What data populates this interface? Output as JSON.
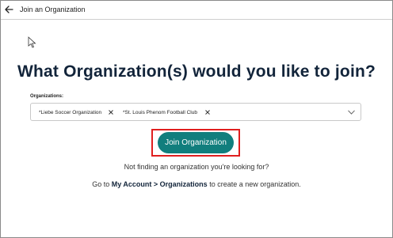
{
  "topbar": {
    "title": "Join an Organization",
    "back_icon": "arrow-left-icon"
  },
  "main": {
    "heading": "What Organization(s) would you like to join?",
    "field_label": "Organizations:",
    "selected_orgs": [
      {
        "label": "*Liebe Soccer Organization"
      },
      {
        "label": "*St. Louis Phenom Football Club"
      }
    ],
    "join_button_label": "Join Organization",
    "not_finding_text": "Not finding an organization you're looking for?",
    "goto_prefix": "Go to ",
    "goto_link": "My Account > Organizations",
    "goto_suffix": " to create a new organization."
  },
  "colors": {
    "primary_button": "#117e7d",
    "heading": "#12243a",
    "highlight": "#e01f1f"
  }
}
